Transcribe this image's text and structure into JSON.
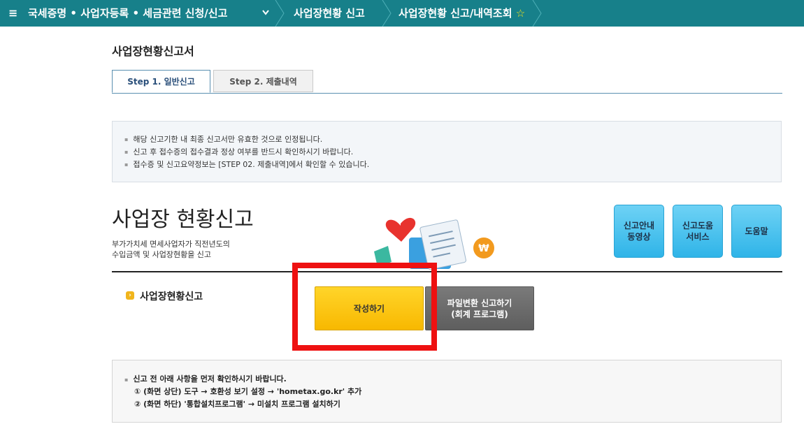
{
  "header": {
    "menu_icon": "≡",
    "crumb1": "국세증명 • 사업자등록 • 세금관련 신청/신고",
    "crumb2": "사업장현황 신고",
    "crumb3": "사업장현황 신고/내역조회",
    "star": "☆",
    "chevron": "❯"
  },
  "page": {
    "title": "사업장현황신고서"
  },
  "tabs": [
    {
      "label": "Step 1. 일반신고"
    },
    {
      "label": "Step 2. 제출내역"
    }
  ],
  "info": [
    "해당 신고기한 내 최종 신고서만 유효한 것으로 인정됩니다.",
    "신고 후 접수증의 접수결과 정상 여부를 반드시 확인하시기 바랍니다.",
    "접수증 및 신고요약정보는 [STEP 02. 제출내역]에서 확인할 수 있습니다."
  ],
  "hero": {
    "title": "사업장 현황신고",
    "desc_line1": "부가가치세 면세사업자가 직전년도의",
    "desc_line2": "수입금액 및 사업장현황을 신고"
  },
  "help_buttons": [
    {
      "line1": "신고안내",
      "line2": "동영상"
    },
    {
      "line1": "신고도움",
      "line2": "서비스"
    },
    {
      "line1": "도움말",
      "line2": ""
    }
  ],
  "section": {
    "bullet": "›",
    "label": "사업장현황신고"
  },
  "actions": {
    "write_label": "작성하기",
    "file_line1": "파일변환 신고하기",
    "file_line2": "(회계 프로그램)"
  },
  "notes": {
    "line1": "신고 전 아래 사항을 먼저 확인하시기 바랍니다.",
    "line2": "① (화면 상단)  도구 → 호환성 보기 설정 →  'hometax.go.kr' 추가",
    "line3": "② (화면 하단)  '통합설치프로그램'  →  미설치 프로그램 설치하기"
  },
  "colors": {
    "topbar": "#17808a",
    "write_button": "#f8c300",
    "file_button": "#666666",
    "highlight": "#ee1111",
    "help_button": "#3bbbea"
  }
}
